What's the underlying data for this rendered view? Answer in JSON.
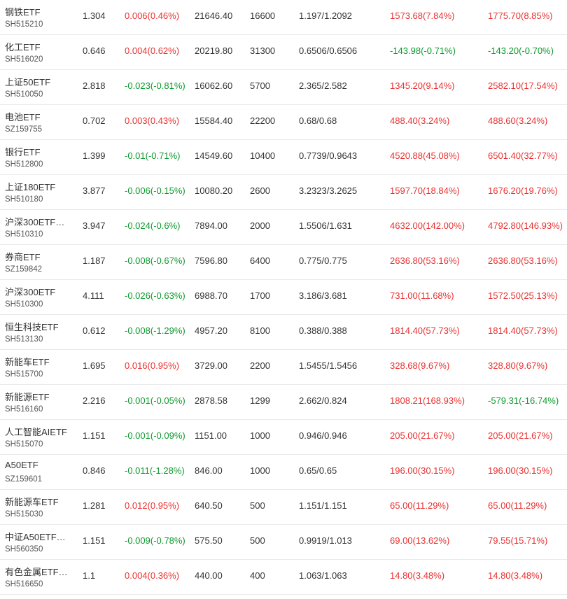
{
  "colors": {
    "up": "#e93030",
    "down": "#0e9a2e",
    "border": "#ebebeb"
  },
  "rows": [
    {
      "name": "钢铁ETF",
      "code": "SH515210",
      "price": "1.304",
      "change": "0.006(0.46%)",
      "change_dir": "up",
      "market_value": "21646.40",
      "quantity": "16600",
      "cost": "1.197/1.2092",
      "pl": "1573.68(7.84%)",
      "pl_dir": "up",
      "total_pl": "1775.70(8.85%)",
      "total_dir": "up"
    },
    {
      "name": "化工ETF",
      "code": "SH516020",
      "price": "0.646",
      "change": "0.004(0.62%)",
      "change_dir": "up",
      "market_value": "20219.80",
      "quantity": "31300",
      "cost": "0.6506/0.6506",
      "pl": "-143.98(-0.71%)",
      "pl_dir": "down",
      "total_pl": "-143.20(-0.70%)",
      "total_dir": "down"
    },
    {
      "name": "上证50ETF",
      "code": "SH510050",
      "price": "2.818",
      "change": "-0.023(-0.81%)",
      "change_dir": "down",
      "market_value": "16062.60",
      "quantity": "5700",
      "cost": "2.365/2.582",
      "pl": "1345.20(9.14%)",
      "pl_dir": "up",
      "total_pl": "2582.10(17.54%)",
      "total_dir": "up"
    },
    {
      "name": "电池ETF",
      "code": "SZ159755",
      "price": "0.702",
      "change": "0.003(0.43%)",
      "change_dir": "up",
      "market_value": "15584.40",
      "quantity": "22200",
      "cost": "0.68/0.68",
      "pl": "488.40(3.24%)",
      "pl_dir": "up",
      "total_pl": "488.60(3.24%)",
      "total_dir": "up"
    },
    {
      "name": "银行ETF",
      "code": "SH512800",
      "price": "1.399",
      "change": "-0.01(-0.71%)",
      "change_dir": "down",
      "market_value": "14549.60",
      "quantity": "10400",
      "cost": "0.7739/0.9643",
      "pl": "4520.88(45.08%)",
      "pl_dir": "up",
      "total_pl": "6501.40(32.77%)",
      "total_dir": "up"
    },
    {
      "name": "上证180ETF",
      "code": "SH510180",
      "price": "3.877",
      "change": "-0.006(-0.15%)",
      "change_dir": "down",
      "market_value": "10080.20",
      "quantity": "2600",
      "cost": "3.2323/3.2625",
      "pl": "1597.70(18.84%)",
      "pl_dir": "up",
      "total_pl": "1676.20(19.76%)",
      "total_dir": "up"
    },
    {
      "name": "沪深300ETF…",
      "code": "SH510310",
      "price": "3.947",
      "change": "-0.024(-0.6%)",
      "change_dir": "down",
      "market_value": "7894.00",
      "quantity": "2000",
      "cost": "1.5506/1.631",
      "pl": "4632.00(142.00%)",
      "pl_dir": "up",
      "total_pl": "4792.80(146.93%)",
      "total_dir": "up"
    },
    {
      "name": "券商ETF",
      "code": "SZ159842",
      "price": "1.187",
      "change": "-0.008(-0.67%)",
      "change_dir": "down",
      "market_value": "7596.80",
      "quantity": "6400",
      "cost": "0.775/0.775",
      "pl": "2636.80(53.16%)",
      "pl_dir": "up",
      "total_pl": "2636.80(53.16%)",
      "total_dir": "up"
    },
    {
      "name": "沪深300ETF",
      "code": "SH510300",
      "price": "4.111",
      "change": "-0.026(-0.63%)",
      "change_dir": "down",
      "market_value": "6988.70",
      "quantity": "1700",
      "cost": "3.186/3.681",
      "pl": "731.00(11.68%)",
      "pl_dir": "up",
      "total_pl": "1572.50(25.13%)",
      "total_dir": "up"
    },
    {
      "name": "恒生科技ETF",
      "code": "SH513130",
      "price": "0.612",
      "change": "-0.008(-1.29%)",
      "change_dir": "down",
      "market_value": "4957.20",
      "quantity": "8100",
      "cost": "0.388/0.388",
      "pl": "1814.40(57.73%)",
      "pl_dir": "up",
      "total_pl": "1814.40(57.73%)",
      "total_dir": "up"
    },
    {
      "name": "新能车ETF",
      "code": "SH515700",
      "price": "1.695",
      "change": "0.016(0.95%)",
      "change_dir": "up",
      "market_value": "3729.00",
      "quantity": "2200",
      "cost": "1.5455/1.5456",
      "pl": "328.68(9.67%)",
      "pl_dir": "up",
      "total_pl": "328.80(9.67%)",
      "total_dir": "up"
    },
    {
      "name": "新能源ETF",
      "code": "SH516160",
      "price": "2.216",
      "change": "-0.001(-0.05%)",
      "change_dir": "down",
      "market_value": "2878.58",
      "quantity": "1299",
      "cost": "2.662/0.824",
      "pl": "1808.21(168.93%)",
      "pl_dir": "up",
      "total_pl": "-579.31(-16.74%)",
      "total_dir": "down"
    },
    {
      "name": "人工智能AIETF",
      "code": "SH515070",
      "price": "1.151",
      "change": "-0.001(-0.09%)",
      "change_dir": "down",
      "market_value": "1151.00",
      "quantity": "1000",
      "cost": "0.946/0.946",
      "pl": "205.00(21.67%)",
      "pl_dir": "up",
      "total_pl": "205.00(21.67%)",
      "total_dir": "up"
    },
    {
      "name": "A50ETF",
      "code": "SZ159601",
      "price": "0.846",
      "change": "-0.011(-1.28%)",
      "change_dir": "down",
      "market_value": "846.00",
      "quantity": "1000",
      "cost": "0.65/0.65",
      "pl": "196.00(30.15%)",
      "pl_dir": "up",
      "total_pl": "196.00(30.15%)",
      "total_dir": "up"
    },
    {
      "name": "新能源车ETF",
      "code": "SH515030",
      "price": "1.281",
      "change": "0.012(0.95%)",
      "change_dir": "up",
      "market_value": "640.50",
      "quantity": "500",
      "cost": "1.151/1.151",
      "pl": "65.00(11.29%)",
      "pl_dir": "up",
      "total_pl": "65.00(11.29%)",
      "total_dir": "up"
    },
    {
      "name": "中证A50ETF…",
      "code": "SH560350",
      "price": "1.151",
      "change": "-0.009(-0.78%)",
      "change_dir": "down",
      "market_value": "575.50",
      "quantity": "500",
      "cost": "0.9919/1.013",
      "pl": "69.00(13.62%)",
      "pl_dir": "up",
      "total_pl": "79.55(15.71%)",
      "total_dir": "up"
    },
    {
      "name": "有色金属ETF…",
      "code": "SH516650",
      "price": "1.1",
      "change": "0.004(0.36%)",
      "change_dir": "up",
      "market_value": "440.00",
      "quantity": "400",
      "cost": "1.063/1.063",
      "pl": "14.80(3.48%)",
      "pl_dir": "up",
      "total_pl": "14.80(3.48%)",
      "total_dir": "up"
    }
  ]
}
